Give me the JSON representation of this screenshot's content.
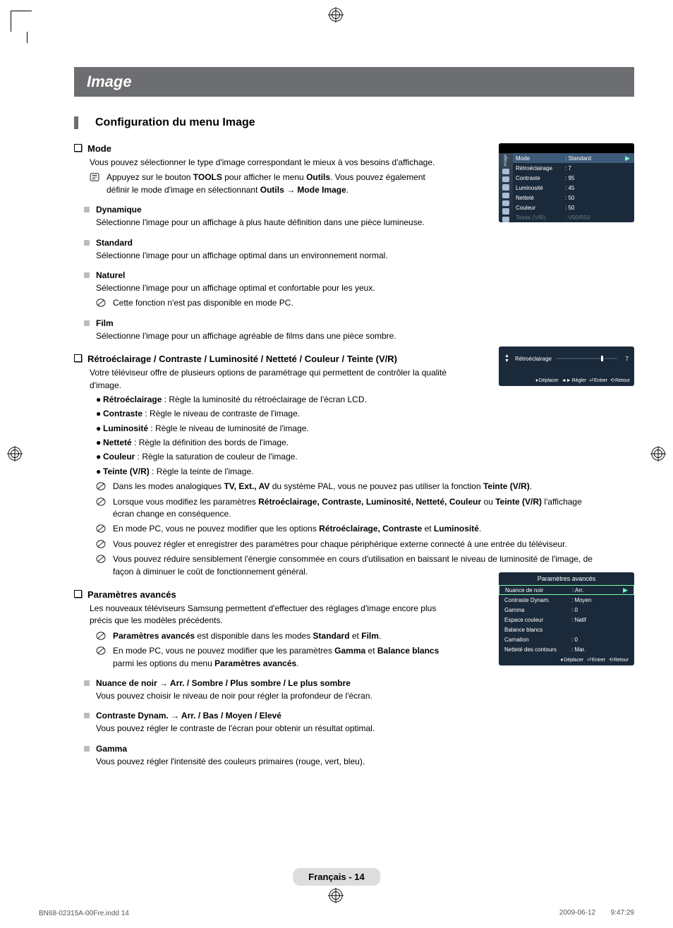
{
  "page": {
    "title": "Image",
    "subtitle": "Configuration du menu Image",
    "footer_badge": "Français - 14",
    "footer_left": "BN68-02315A-00Fre.indd   14",
    "footer_right": "2009-06-12    9:47:29"
  },
  "mode": {
    "heading": "Mode",
    "intro": "Vous pouvez sélectionner le type d'image correspondant le mieux à vos besoins d'affichage.",
    "tools_pre": "Appuyez sur le bouton ",
    "tools_b1": "TOOLS",
    "tools_mid1": " pour afficher le menu ",
    "tools_b2": "Outils",
    "tools_mid2": ". Vous pouvez également définir le mode d'image en sélectionnant ",
    "tools_b3": "Outils → Mode Image",
    "tools_end": ".",
    "dyn_h": "Dynamique",
    "dyn_d": "Sélectionne l'image pour un affichage à plus haute définition dans une pièce lumineuse.",
    "std_h": "Standard",
    "std_d": "Sélectionne l'image pour un affichage optimal dans un environnement normal.",
    "nat_h": "Naturel",
    "nat_d": "Sélectionne l'image pour un affichage optimal et confortable pour les yeux.",
    "nat_note": "Cette fonction n'est pas disponible en mode PC.",
    "film_h": "Film",
    "film_d": "Sélectionne l'image pour un affichage agréable de films dans une pièce sombre."
  },
  "params": {
    "heading": "Rétroéclairage / Contraste / Luminosité / Netteté / Couleur / Teinte (V/R)",
    "intro": "Votre téléviseur offre de plusieurs options de paramétrage qui permettent de contrôler la qualité d'image.",
    "b1_b": "Rétroéclairage",
    "b1_t": " : Règle la luminosité du rétroéclairage de l'écran LCD.",
    "b2_b": "Contraste",
    "b2_t": " : Règle le niveau de contraste de l'image.",
    "b3_b": "Luminosité",
    "b3_t": " : Règle le niveau de luminosité de l'image.",
    "b4_b": "Netteté",
    "b4_t": " : Règle la définition des bords de l'image.",
    "b5_b": "Couleur",
    "b5_t": " : Règle la saturation de couleur de l'image.",
    "b6_b": "Teinte (V/R)",
    "b6_t": " : Règle la teinte de l'image.",
    "n1_a": "Dans les modes analogiques ",
    "n1_b": "TV, Ext., AV",
    "n1_c": " du système PAL, vous ne pouvez pas utiliser la fonction ",
    "n1_d": "Teinte (V/R)",
    "n1_e": ".",
    "n2_a": "Lorsque vous modifiez les paramètres ",
    "n2_b": "Rétroéclairage, Contraste, Luminosité, Netteté, Couleur",
    "n2_c": " ou ",
    "n2_d": "Teinte (V/R)",
    "n2_e": " l'affichage écran change en conséquence.",
    "n3_a": "En mode PC, vous ne pouvez modifier que les options ",
    "n3_b": "Rétroéclairage, Contraste",
    "n3_c": " et ",
    "n3_d": "Luminosité",
    "n3_e": ".",
    "n4": "Vous pouvez régler et enregistrer des paramètres pour chaque périphérique externe connecté à une entrée du téléviseur.",
    "n5": "Vous pouvez réduire sensiblement l'énergie consommée en cours d'utilisation en baissant le niveau de luminosité de l'image, de façon à diminuer le coût de fonctionnement général."
  },
  "adv": {
    "heading": "Paramètres avancés",
    "intro": "Les nouveaux téléviseurs Samsung permettent d'effectuer des réglages d'image encore plus précis que les modèles précédents.",
    "n1_a": "Paramètres avancés",
    "n1_b": " est disponible dans les modes ",
    "n1_c": "Standard",
    "n1_d": " et ",
    "n1_e": "Film",
    "n1_f": ".",
    "n2_a": "En mode PC, vous ne pouvez modifier que les paramètres ",
    "n2_b": "Gamma",
    "n2_c": " et ",
    "n2_d": "Balance blancs",
    "n2_e": " parmi les options du menu ",
    "n2_f": "Paramètres avancés",
    "n2_g": ".",
    "nb_h": "Nuance de noir → Arr. / Sombre / Plus sombre / Le plus sombre",
    "nb_d": "Vous pouvez choisir le niveau de noir pour régler la profondeur de l'écran.",
    "cd_h": "Contraste Dynam. → Arr. / Bas / Moyen / Elevé",
    "cd_d": "Vous pouvez régler le contraste de l'écran pour obtenir un résultat optimal.",
    "g_h": "Gamma",
    "g_d": "Vous pouvez régler l'intensité des couleurs primaires (rouge, vert, bleu)."
  },
  "osd1": {
    "sidebar_label": "Image",
    "mode_l": "Mode",
    "mode_v": ": Standard",
    "rows": [
      {
        "l": "Rétroéclairage",
        "v": ": 7"
      },
      {
        "l": "Contraste",
        "v": ": 95"
      },
      {
        "l": "Luminosité",
        "v": ": 45"
      },
      {
        "l": "Netteté",
        "v": ": 50"
      },
      {
        "l": "Couleur",
        "v": ": 50"
      }
    ],
    "dim_l": "Teinte (V/R)",
    "dim_v": ": V50/R50"
  },
  "osd2": {
    "label": "Rétroéclairage",
    "value": "7",
    "help": [
      "Déplacer",
      "Régler",
      "Entrer",
      "Retour"
    ]
  },
  "osd3": {
    "title": "Paramètres avancés",
    "rows": [
      {
        "l": "Nuance de noir",
        "v": ": Arr.",
        "sel": true
      },
      {
        "l": "Contraste Dynam.",
        "v": ": Moyen"
      },
      {
        "l": "Gamma",
        "v": ": 0"
      },
      {
        "l": "Espace couleur",
        "v": ": Natif"
      },
      {
        "l": "Balance blancs",
        "v": ""
      },
      {
        "l": "Carnation",
        "v": ": 0"
      },
      {
        "l": "Netteté des contours",
        "v": ": Mar."
      }
    ],
    "help": [
      "Déplacer",
      "Entrer",
      "Retour"
    ]
  }
}
